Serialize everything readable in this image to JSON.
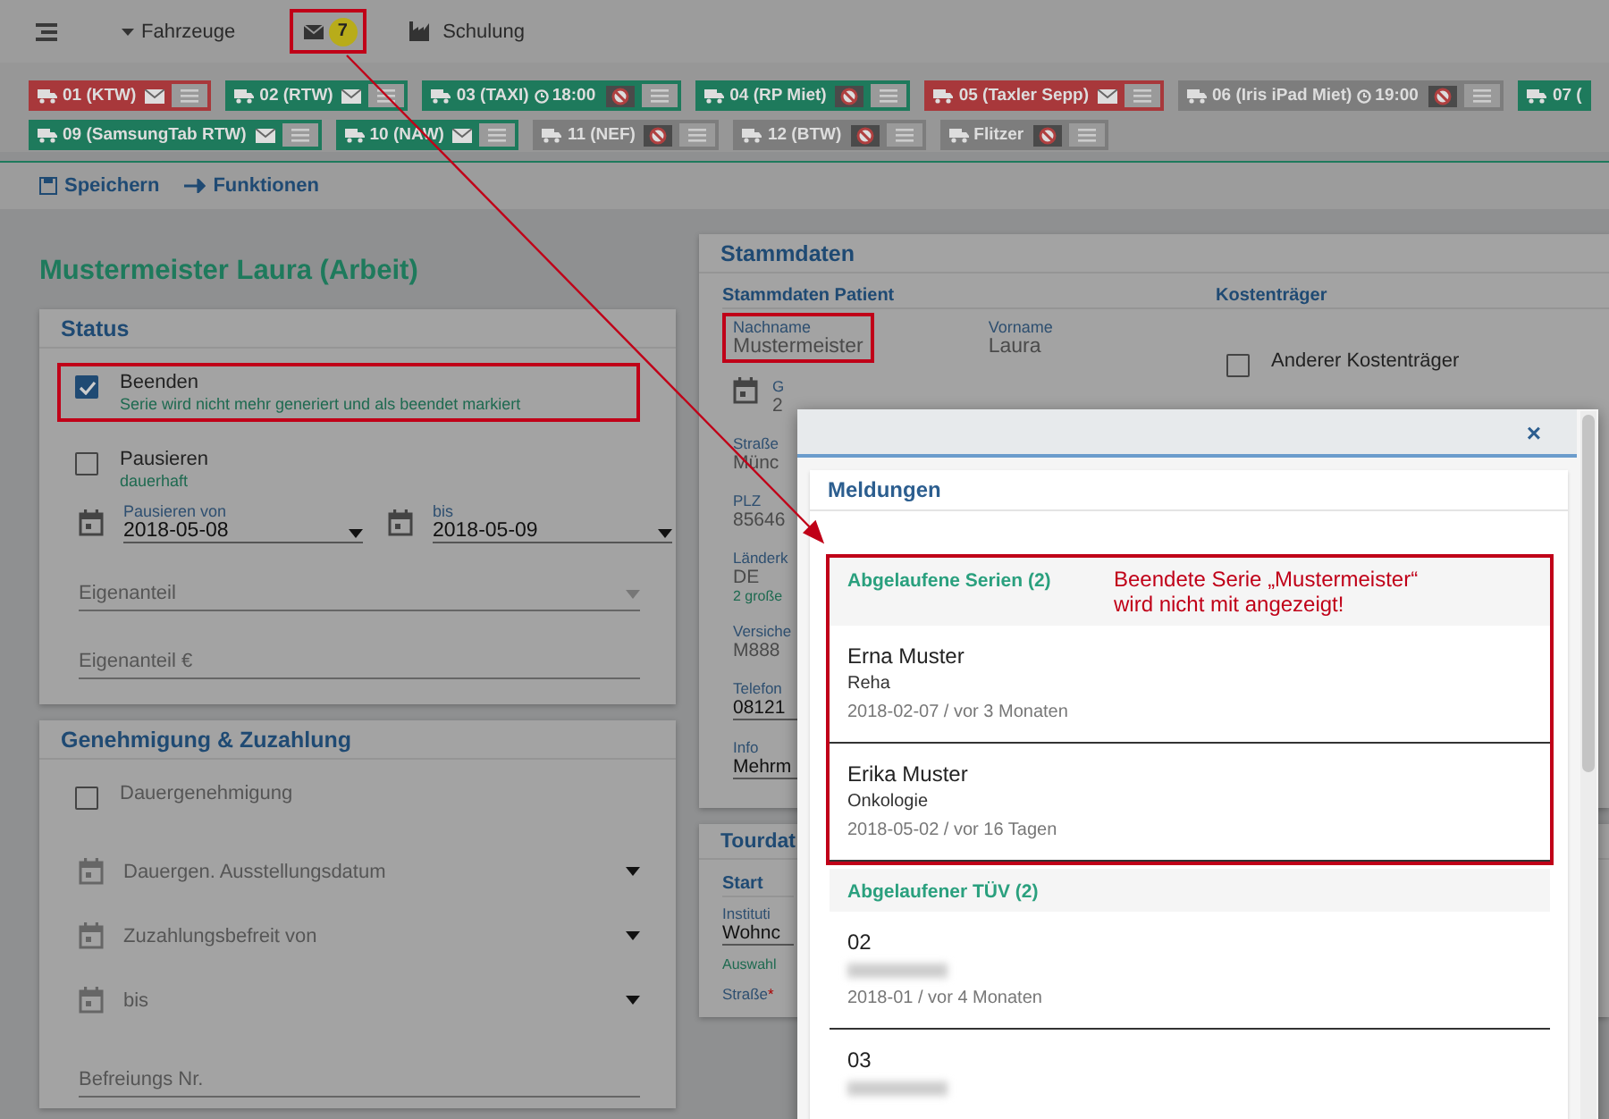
{
  "topbar": {
    "vehicles_menu": "Fahrzeuge",
    "messages": {
      "count": "7",
      "annotated": true
    },
    "training": "Schulung"
  },
  "vehicle_rows": [
    [
      {
        "label": "01 (KTW)",
        "color": "#a8383b",
        "kind": "mail"
      },
      {
        "label": "02 (RTW)",
        "color": "#1e7a5c",
        "kind": "mail"
      },
      {
        "label": "03 (TAXI)",
        "time": "18:00",
        "color": "#1e7a5c",
        "kind": "blocked"
      },
      {
        "label": "04 (RP Miet)",
        "color": "#1e7a5c",
        "kind": "blocked"
      },
      {
        "label": "05 (Taxler Sepp)",
        "color": "#a8383b",
        "kind": "mail"
      },
      {
        "label": "06 (Iris iPad Miet)",
        "time": "19:00",
        "color": "#7d7d7d",
        "kind": "blocked"
      },
      {
        "label": "07 (",
        "color": "#1e7a5c",
        "kind": "cut"
      }
    ],
    [
      {
        "label": "09 (SamsungTab RTW)",
        "color": "#1e7a5c",
        "kind": "mail"
      },
      {
        "label": "10 (NAW)",
        "color": "#1e7a5c",
        "kind": "mail"
      },
      {
        "label": "11 (NEF)",
        "color": "#7d7d7d",
        "kind": "blocked"
      },
      {
        "label": "12 (BTW)",
        "color": "#7d7d7d",
        "kind": "blocked"
      },
      {
        "label": "Flitzer",
        "color": "#7d7d7d",
        "kind": "blocked"
      }
    ]
  ],
  "toolbar": [
    "Speichern",
    "Funktionen"
  ],
  "left": {
    "title": "Mustermeister Laura (Arbeit)",
    "status_card": {
      "title": "Status",
      "options": [
        {
          "label": "Beenden",
          "hint": "Serie wird nicht mehr generiert und als beendet markiert",
          "checked": true,
          "annotated": true
        },
        {
          "label": "Pausieren",
          "hint": "dauerhaft",
          "checked": false,
          "annotated": false
        }
      ],
      "date_fields": [
        {
          "label": "Pausieren von",
          "value": "2018-05-08"
        },
        {
          "label": "bis",
          "value": "2018-05-09"
        }
      ],
      "select": {
        "placeholder": "Eigenanteil"
      },
      "input": {
        "placeholder": "Eigenanteil €"
      }
    },
    "approval_card": {
      "title": "Genehmigung & Zuzahlung",
      "checkbox": {
        "label": "Dauergenehmigung",
        "checked": false
      },
      "date_fields": [
        {
          "placeholder": "Dauergen. Ausstellungsdatum"
        },
        {
          "placeholder": "Zuzahlungsbefreit von"
        },
        {
          "placeholder": "bis"
        }
      ],
      "input": {
        "placeholder": "Befreiungs Nr."
      }
    }
  },
  "stammdaten": {
    "title": "Stammdaten",
    "patient_heading": "Stammdaten Patient",
    "cost_heading": "Kostenträger",
    "fields": [
      {
        "label": "Nachname",
        "value": "Mustermeister",
        "annotated": true
      },
      {
        "label": "Vorname",
        "value": "Laura",
        "annotated": false
      }
    ],
    "cost_checkbox": {
      "label": "Anderer Kostenträger",
      "checked": false
    },
    "partial_fields": [
      {
        "kind": "date",
        "label": "G",
        "value": "2"
      },
      {
        "kind": "plain",
        "label": "Straße",
        "value": "Münc"
      },
      {
        "kind": "plain",
        "label": "PLZ",
        "value": "85646"
      },
      {
        "kind": "plain",
        "label": "Länderk",
        "value": "DE",
        "note": "2 große"
      },
      {
        "kind": "plain",
        "label": "Versiche",
        "value": "M888"
      },
      {
        "kind": "underlined",
        "label": "Telefon",
        "value": "08121"
      },
      {
        "kind": "underlined",
        "label": "Info",
        "value": "Mehrm"
      }
    ]
  },
  "tourdaten": {
    "title": "Tourdat",
    "start_heading": "Start",
    "fields": [
      {
        "label": "Instituti",
        "value": "Wohnc",
        "note": "Auswahl"
      },
      {
        "label": "Straße",
        "marker": "*"
      }
    ]
  },
  "modal": {
    "close": "×",
    "title": "Meldungen",
    "sections": [
      {
        "heading": "Abgelaufene Serien (2)",
        "annotated": true,
        "note": [
          "Beendete Serie „Mustermeister“",
          "wird nicht mit angezeigt!"
        ],
        "items": [
          {
            "title": "Erna Muster",
            "subtitle": "Reha",
            "redacted": false,
            "meta": "2018-02-07 / vor 3 Monaten"
          },
          {
            "title": "Erika Muster",
            "subtitle": "Onkologie",
            "redacted": false,
            "meta": "2018-05-02 / vor 16 Tagen"
          }
        ]
      },
      {
        "heading": "Abgelaufener TÜV (2)",
        "annotated": false,
        "items": [
          {
            "title": "02",
            "redacted": true,
            "meta": "2018-01 / vor 4 Monaten"
          },
          {
            "title": "03",
            "redacted": true
          }
        ]
      }
    ]
  }
}
